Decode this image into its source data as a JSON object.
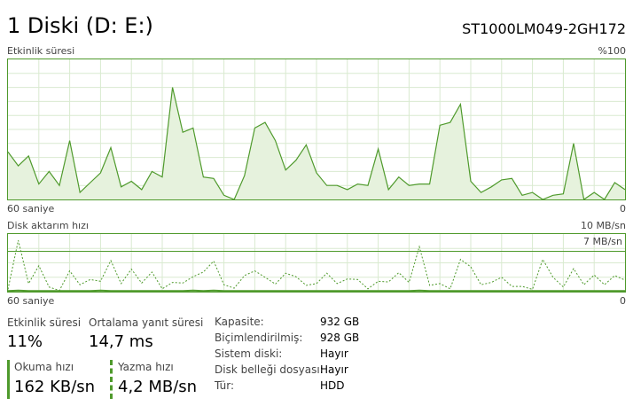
{
  "header": {
    "title": "1 Diski (D: E:)",
    "model": "ST1000LM049-2GH172"
  },
  "activity": {
    "label": "Etkinlik süresi",
    "max_label": "%100",
    "time_label": "60 saniye",
    "min_label": "0"
  },
  "transfer": {
    "label": "Disk aktarım hızı",
    "max_label": "10 MB/sn",
    "line_label": "7 MB/sn",
    "time_label": "60 saniye",
    "min_label": "0"
  },
  "stats": {
    "activity_label": "Etkinlik süresi",
    "activity_value": "11%",
    "response_label": "Ortalama yanıt süresi",
    "response_value": "14,7 ms",
    "read_label": "Okuma hızı",
    "read_value": "162 KB/sn",
    "write_label": "Yazma hızı",
    "write_value": "4,2 MB/sn"
  },
  "properties": [
    {
      "key": "Kapasite:",
      "value": "932 GB"
    },
    {
      "key": "Biçimlendirilmiş:",
      "value": "928 GB"
    },
    {
      "key": "Sistem diski:",
      "value": "Hayır"
    },
    {
      "key": "Disk belleği dosyası:",
      "value": "Hayır"
    },
    {
      "key": "Tür:",
      "value": "HDD"
    }
  ],
  "colors": {
    "accent": "#4f9a2c",
    "fill": "#e6f2dd",
    "grid": "#d9ead0"
  },
  "chart_data": [
    {
      "type": "area",
      "ylabel": "Etkinlik süresi",
      "ylim": [
        0,
        100
      ],
      "x": [
        0,
        1,
        2,
        3,
        4,
        5,
        6,
        7,
        8,
        9,
        10,
        11,
        12,
        13,
        14,
        15,
        16,
        17,
        18,
        19,
        20,
        21,
        22,
        23,
        24,
        25,
        26,
        27,
        28,
        29,
        30,
        31,
        32,
        33,
        34,
        35,
        36,
        37,
        38,
        39,
        40,
        41,
        42,
        43,
        44,
        45,
        46,
        47,
        48,
        49,
        50,
        51,
        52,
        53,
        54,
        55,
        56,
        57,
        58,
        59,
        60
      ],
      "series": [
        {
          "values": [
            34,
            24,
            31,
            11,
            20,
            10,
            42,
            5,
            12,
            19,
            37,
            9,
            13,
            7,
            20,
            16,
            80,
            48,
            51,
            16,
            15,
            3,
            0,
            17,
            51,
            55,
            42,
            21,
            28,
            39,
            19,
            10,
            10,
            7,
            11,
            10,
            36,
            7,
            16,
            10,
            11,
            11,
            53,
            55,
            68,
            13,
            5,
            9,
            14,
            15,
            3,
            5,
            0,
            3,
            4,
            40,
            0,
            5,
            0,
            12,
            7
          ]
        }
      ]
    },
    {
      "type": "line",
      "ylabel": "Disk aktarım hızı (MB/sn)",
      "ylim": [
        0,
        10
      ],
      "x": [
        0,
        1,
        2,
        3,
        4,
        5,
        6,
        7,
        8,
        9,
        10,
        11,
        12,
        13,
        14,
        15,
        16,
        17,
        18,
        19,
        20,
        21,
        22,
        23,
        24,
        25,
        26,
        27,
        28,
        29,
        30,
        31,
        32,
        33,
        34,
        35,
        36,
        37,
        38,
        39,
        40,
        41,
        42,
        43,
        44,
        45,
        46,
        47,
        48,
        49,
        50,
        51,
        52,
        53,
        54,
        55,
        56,
        57,
        58,
        59,
        60
      ],
      "series": [
        {
          "name": "Yazma hızı",
          "dashed": true,
          "values": [
            0.4,
            8.9,
            1.4,
            4.5,
            0.8,
            0.2,
            3.6,
            1.2,
            2.1,
            1.8,
            5.4,
            1.4,
            3.9,
            1.5,
            3.4,
            0.5,
            1.6,
            1.5,
            2.6,
            3.4,
            5.3,
            1.2,
            0.6,
            2.8,
            3.6,
            2.5,
            1.3,
            3.2,
            2.6,
            1.1,
            1.4,
            3.2,
            1.4,
            2.2,
            2.1,
            0.5,
            1.8,
            1.7,
            3.3,
            1.6,
            7.8,
            1.1,
            1.4,
            0.5,
            5.6,
            4.3,
            1.2,
            1.6,
            2.5,
            0.9,
            0.9,
            0.4,
            5.6,
            2.5,
            0.8,
            4.0,
            1.2,
            2.9,
            1.2,
            2.8,
            2.0
          ]
        },
        {
          "name": "Okuma hızı",
          "dashed": false,
          "values": [
            0.1,
            0.2,
            0.1,
            0.1,
            0.1,
            0.1,
            0.1,
            0.1,
            0.1,
            0.2,
            0.1,
            0.1,
            0.1,
            0.1,
            0.1,
            0.1,
            0.1,
            0.1,
            0.2,
            0.1,
            0.2,
            0.1,
            0.1,
            0.1,
            0.1,
            0.1,
            0.1,
            0.1,
            0.1,
            0.1,
            0.1,
            0.1,
            0.1,
            0.1,
            0.1,
            0.1,
            0.1,
            0.1,
            0.1,
            0.1,
            0.2,
            0.1,
            0.1,
            0.1,
            0.1,
            0.1,
            0.1,
            0.1,
            0.1,
            0.1,
            0.1,
            0.1,
            0.1,
            0.1,
            0.1,
            0.1,
            0.1,
            0.1,
            0.1,
            0.1,
            0.1
          ]
        }
      ],
      "reference_line": 7
    }
  ]
}
